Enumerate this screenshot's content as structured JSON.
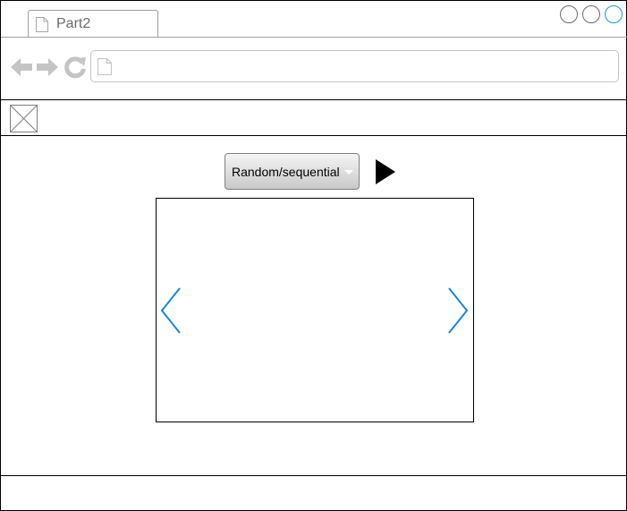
{
  "browser": {
    "tab": {
      "title": "Part2",
      "icon": "document-icon"
    },
    "window_controls": [
      "minimize",
      "maximize",
      "close"
    ],
    "nav": {
      "back": "back-arrow-icon",
      "forward": "forward-arrow-icon",
      "reload": "reload-icon"
    },
    "url": {
      "value": "",
      "icon": "document-icon"
    }
  },
  "header": {
    "logo": "image-placeholder-icon"
  },
  "controls": {
    "mode_select": {
      "label": "Random/sequential"
    },
    "play": "play-icon"
  },
  "viewer": {
    "prev": "chevron-left-icon",
    "next": "chevron-right-icon",
    "accent": "#1a86d6"
  }
}
